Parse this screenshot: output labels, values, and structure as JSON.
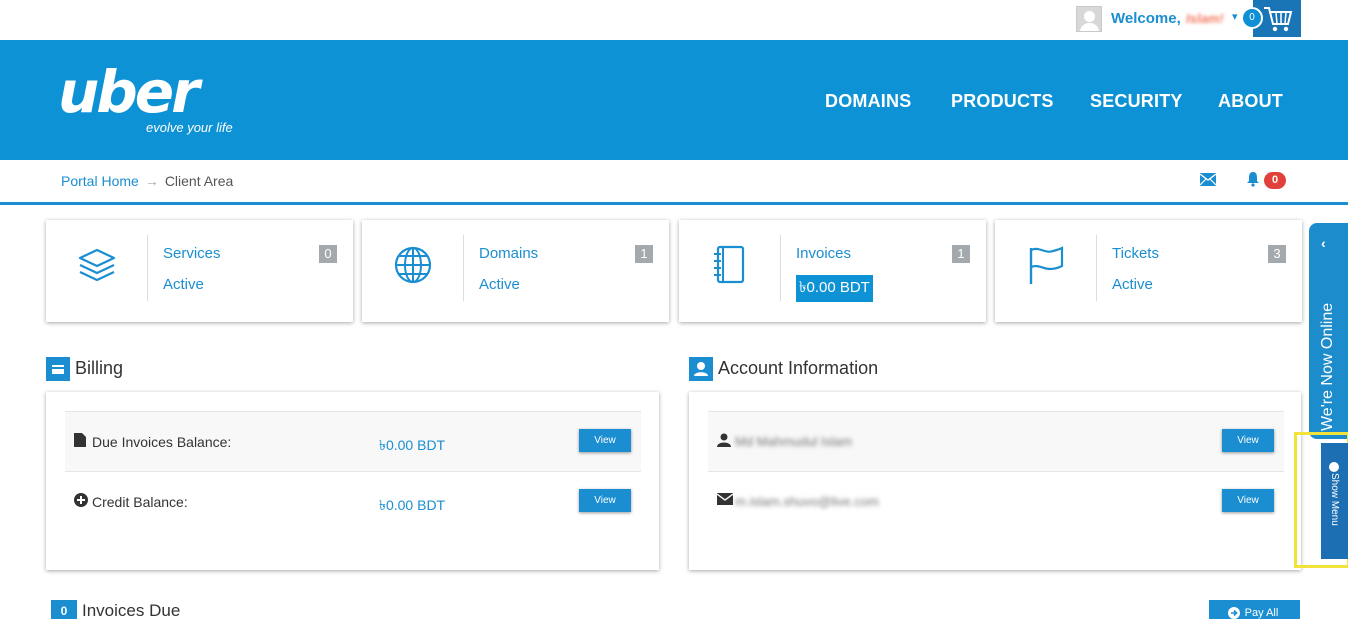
{
  "topbar": {
    "welcome": "Welcome,",
    "username": "Islam!",
    "cart_count": "0"
  },
  "header": {
    "logo_word": "uber",
    "logo_tagline": "evolve your life",
    "nav": [
      "DOMAINS",
      "PRODUCTS",
      "SECURITY",
      "ABOUT"
    ]
  },
  "breadcrumb": {
    "home": "Portal Home",
    "separator": "→",
    "current": "Client Area",
    "notification_count": "0"
  },
  "tiles": [
    {
      "title": "Services",
      "sub": "Active",
      "count": "0",
      "icon": "layers-icon"
    },
    {
      "title": "Domains",
      "sub": "Active",
      "count": "1",
      "icon": "globe-icon"
    },
    {
      "title": "Invoices",
      "sub": "৳0.00 BDT",
      "count": "1",
      "icon": "notebook-icon"
    },
    {
      "title": "Tickets",
      "sub": "Active",
      "count": "3",
      "icon": "flag-icon"
    }
  ],
  "billing": {
    "title": "Billing",
    "rows": [
      {
        "label": "Due Invoices Balance:",
        "value": "৳0.00 BDT",
        "button": "View"
      },
      {
        "label": "Credit Balance:",
        "value": "৳0.00 BDT",
        "button": "View"
      }
    ]
  },
  "account": {
    "title": "Account Information",
    "rows": [
      {
        "value": "Md Mahmudul Islam",
        "button": "View"
      },
      {
        "value": "m.islam.shuvo@live.com",
        "button": "View"
      }
    ]
  },
  "invoices_due": {
    "count": "0",
    "title": "Invoices Due",
    "pay_all": "Pay All"
  },
  "side": {
    "online": "We're Now Online",
    "show_menu": "Show Menu"
  },
  "colors": {
    "brand": "#0e92d6",
    "badge_red": "#e2413b",
    "highlight": "#f2e23c"
  }
}
